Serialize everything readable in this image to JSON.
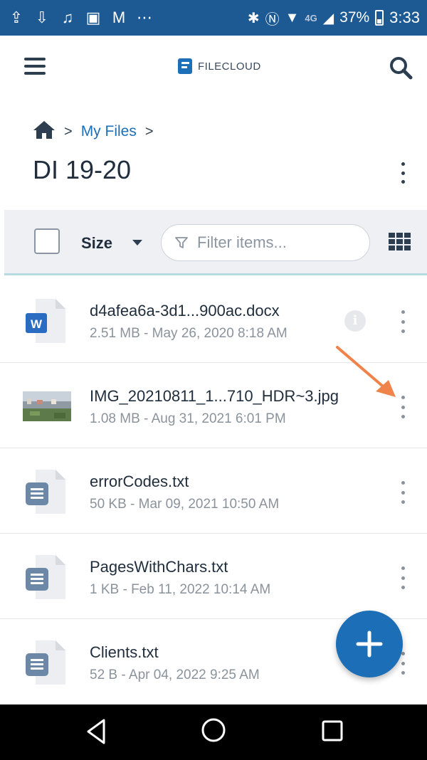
{
  "status_bar": {
    "net_label": "4G",
    "battery": "37%",
    "time": "3:33"
  },
  "header": {
    "logo_text": "FILECLOUD"
  },
  "breadcrumb": {
    "items": [
      "My Files"
    ]
  },
  "page_title": "DI 19-20",
  "toolbar": {
    "sort_label": "Size",
    "filter_placeholder": "Filter items..."
  },
  "files": [
    {
      "name": "d4afea6a-3d1...900ac.docx",
      "meta": "2.51 MB - May 26, 2020 8:18 AM",
      "icon": "word-doc-icon",
      "has_info": true
    },
    {
      "name": "IMG_20210811_1...710_HDR~3.jpg",
      "meta": "1.08 MB - Aug 31, 2021 6:01 PM",
      "icon": "image-thumbnail",
      "has_info": false
    },
    {
      "name": "errorCodes.txt",
      "meta": "50 KB - Mar 09, 2021 10:50 AM",
      "icon": "text-file-icon",
      "has_info": false
    },
    {
      "name": "PagesWithChars.txt",
      "meta": "1 KB - Feb 11, 2022 10:14 AM",
      "icon": "text-file-icon",
      "has_info": false
    },
    {
      "name": "Clients.txt",
      "meta": "52 B - Apr 04, 2022 9:25 AM",
      "icon": "text-file-icon",
      "has_info": false
    }
  ],
  "colors": {
    "status_bar": "#1d5a93",
    "accent": "#1c6fb7",
    "annotation_arrow": "#f0834a"
  }
}
